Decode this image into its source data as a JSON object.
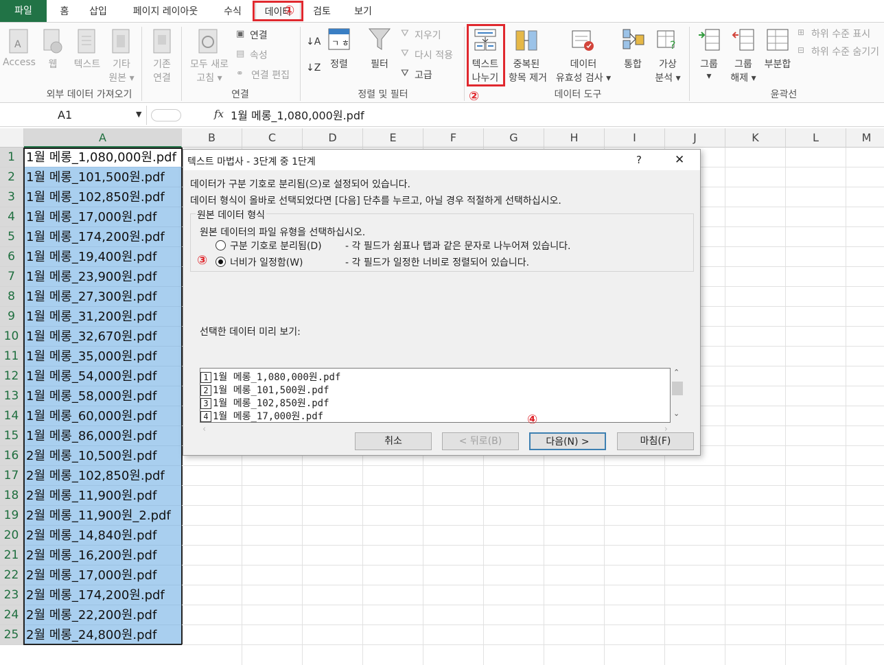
{
  "tabs": [
    "파일",
    "홈",
    "삽입",
    "페이지 레이아웃",
    "수식",
    "데이터",
    "검토",
    "보기"
  ],
  "annotations": [
    "①",
    "②",
    "③",
    "④"
  ],
  "ribbon": {
    "external": {
      "access": "Access",
      "web": "웹",
      "text": "텍스트",
      "other": "기타",
      "other2": "원본 ▾",
      "existing": "기존",
      "existing2": "연결",
      "group": "외부 데이터 가져오기"
    },
    "connections": {
      "refresh": "모두 새로",
      "refresh2": "고침 ▾",
      "conn": "연결",
      "props": "속성",
      "edit": "연결 편집",
      "group": "연결"
    },
    "sort": {
      "sort": "정렬",
      "filter": "필터",
      "clear": "지우기",
      "reapply": "다시 적용",
      "advanced": "고급",
      "group": "정렬 및 필터"
    },
    "tools": {
      "t2c": "텍스트",
      "t2c2": "나누기",
      "dup": "중복된",
      "dup2": "항목 제거",
      "valid": "데이터",
      "valid2": "유효성 검사 ▾",
      "consol": "통합",
      "whatif": "가상",
      "whatif2": "분석 ▾",
      "group": "데이터 도구"
    },
    "outline": {
      "group_btn": "그룹",
      "group_btn2": "▾",
      "ungroup": "그룹",
      "ungroup2": "해제 ▾",
      "subtotal": "부분합",
      "show": "하위 수준 표시",
      "hide": "하위 수준 숨기기",
      "group": "윤곽선"
    }
  },
  "formula_bar": {
    "name_box": "A1",
    "fx": "fx",
    "value": "1월 메롱_1,080,000원.pdf"
  },
  "columns": [
    "A",
    "B",
    "C",
    "D",
    "E",
    "F",
    "G",
    "H",
    "I",
    "J",
    "K",
    "L",
    "M"
  ],
  "rows": [
    {
      "n": "1",
      "v": "1월 메롱_1,080,000원.pdf"
    },
    {
      "n": "2",
      "v": "1월 메롱_101,500원.pdf"
    },
    {
      "n": "3",
      "v": "1월 메롱_102,850원.pdf"
    },
    {
      "n": "4",
      "v": "1월 메롱_17,000원.pdf"
    },
    {
      "n": "5",
      "v": "1월 메롱_174,200원.pdf"
    },
    {
      "n": "6",
      "v": "1월 메롱_19,400원.pdf"
    },
    {
      "n": "7",
      "v": "1월 메롱_23,900원.pdf"
    },
    {
      "n": "8",
      "v": "1월 메롱_27,300원.pdf"
    },
    {
      "n": "9",
      "v": "1월 메롱_31,200원.pdf"
    },
    {
      "n": "10",
      "v": "1월 메롱_32,670원.pdf"
    },
    {
      "n": "11",
      "v": "1월 메롱_35,000원.pdf"
    },
    {
      "n": "12",
      "v": "1월 메롱_54,000원.pdf"
    },
    {
      "n": "13",
      "v": "1월 메롱_58,000원.pdf"
    },
    {
      "n": "14",
      "v": "1월 메롱_60,000원.pdf"
    },
    {
      "n": "15",
      "v": "1월 메롱_86,000원.pdf"
    },
    {
      "n": "16",
      "v": "2월 메롱_10,500원.pdf"
    },
    {
      "n": "17",
      "v": "2월 메롱_102,850원.pdf"
    },
    {
      "n": "18",
      "v": "2월 메롱_11,900원.pdf"
    },
    {
      "n": "19",
      "v": "2월 메롱_11,900원_2.pdf"
    },
    {
      "n": "20",
      "v": "2월 메롱_14,840원.pdf"
    },
    {
      "n": "21",
      "v": "2월 메롱_16,200원.pdf"
    },
    {
      "n": "22",
      "v": "2월 메롱_17,000원.pdf"
    },
    {
      "n": "23",
      "v": "2월 메롱_174,200원.pdf"
    },
    {
      "n": "24",
      "v": "2월 메롱_22,200원.pdf"
    },
    {
      "n": "25",
      "v": "2월 메롱_24,800원.pdf"
    }
  ],
  "dialog": {
    "title": "텍스트 마법사 - 3단계 중 1단계",
    "help": "?",
    "close": "✕",
    "line1": "데이터가 구분 기호로 분리됨(으)로 설정되어 있습니다.",
    "line2": "데이터 형식이 올바로 선택되었다면 [다음] 단추를 누르고, 아닐 경우 적절하게 선택하십시오.",
    "section": "원본 데이터 형식",
    "prompt": "원본 데이터의 파일 유형을 선택하십시오.",
    "opt1": "구분 기호로 분리됨(D)",
    "opt1_desc": "- 각 필드가 쉼표나 탭과 같은 문자로 나누어져 있습니다.",
    "opt2": "너비가 일정함(W)",
    "opt2_desc": "- 각 필드가 일정한 너비로 정렬되어 있습니다.",
    "preview_label": "선택한 데이터 미리 보기:",
    "preview": [
      {
        "n": "1",
        "t": "1월 메롱_1,080,000원.pdf"
      },
      {
        "n": "2",
        "t": "1월 메롱_101,500원.pdf"
      },
      {
        "n": "3",
        "t": "1월 메롱_102,850원.pdf"
      },
      {
        "n": "4",
        "t": "1월 메롱_17,000원.pdf"
      }
    ],
    "btn_cancel": "취소",
    "btn_back": "< 뒤로(B)",
    "btn_next": "다음(N) >",
    "btn_finish": "마침(F)"
  },
  "colors": {
    "accent": "#217346",
    "highlight": "#e0282e",
    "selection": "#a9cfef"
  }
}
